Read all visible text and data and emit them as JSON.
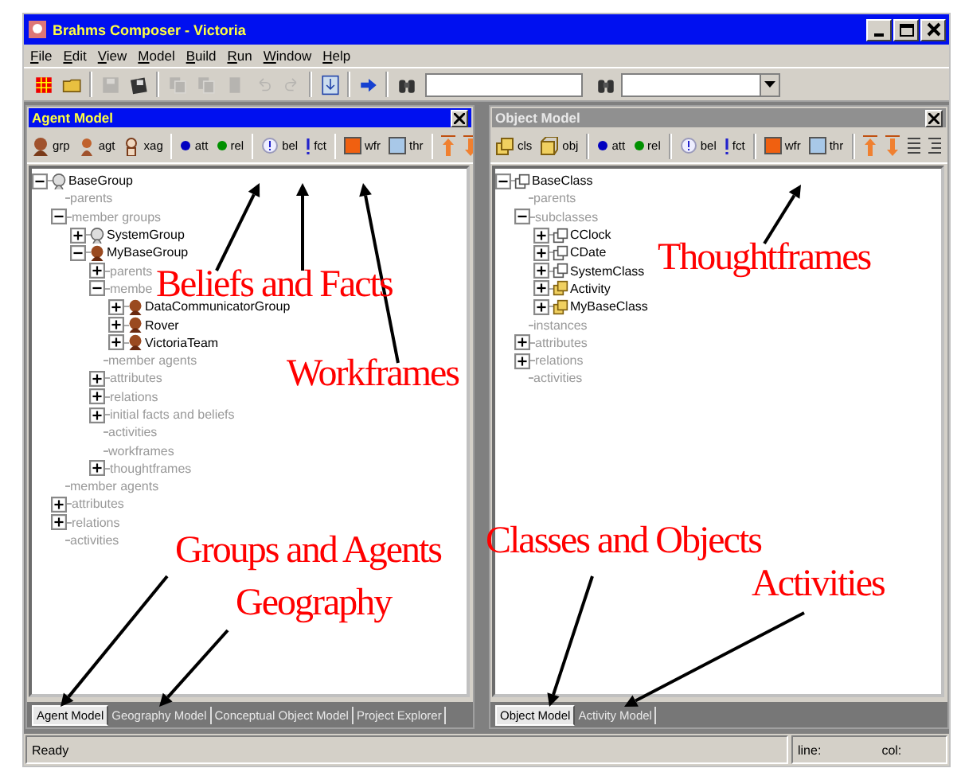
{
  "window": {
    "title": "Brahms Composer - Victoria"
  },
  "menu": [
    "File",
    "Edit",
    "View",
    "Model",
    "Build",
    "Run",
    "Window",
    "Help"
  ],
  "toolbar": [
    {
      "kind": "new",
      "disabled": false
    },
    {
      "kind": "open",
      "disabled": false
    },
    {
      "kind": "separator"
    },
    {
      "kind": "save",
      "disabled": true
    },
    {
      "kind": "save-all",
      "disabled": false
    },
    {
      "kind": "separator"
    },
    {
      "kind": "copy",
      "disabled": true
    },
    {
      "kind": "paste",
      "disabled": true
    },
    {
      "kind": "cut",
      "disabled": true
    },
    {
      "kind": "undo",
      "disabled": true
    },
    {
      "kind": "redo",
      "disabled": true
    },
    {
      "kind": "separator"
    },
    {
      "kind": "compile",
      "disabled": false
    },
    {
      "kind": "separator"
    },
    {
      "kind": "run",
      "disabled": false
    },
    {
      "kind": "separator"
    },
    {
      "kind": "find",
      "disabled": false
    },
    {
      "kind": "text-field"
    },
    {
      "kind": "find",
      "disabled": false
    },
    {
      "kind": "combo"
    }
  ],
  "panels": [
    {
      "title": "Agent Model",
      "active": true,
      "tools": [
        [
          {
            "kind": "group",
            "label": "grp"
          },
          {
            "kind": "agent",
            "label": "agt"
          },
          {
            "kind": "external-agent",
            "label": "xag"
          }
        ],
        [
          {
            "kind": "attribute",
            "label": "att"
          },
          {
            "kind": "relation",
            "label": "rel"
          }
        ],
        [
          {
            "kind": "belief",
            "label": "bel"
          },
          {
            "kind": "fact",
            "label": "fct"
          }
        ],
        [
          {
            "kind": "workframe",
            "label": "wfr"
          },
          {
            "kind": "thoughtframe",
            "label": "thr"
          }
        ],
        [
          {
            "kind": "move-up"
          },
          {
            "kind": "move-down"
          }
        ]
      ],
      "tree": [
        {
          "label": "BaseGroup",
          "kind": "system-group",
          "expanded": true,
          "children": [
            {
              "label": "parents",
              "kind": "category"
            },
            {
              "label": "member groups",
              "kind": "category",
              "expanded": true,
              "children": [
                {
                  "label": "SystemGroup",
                  "kind": "system-group",
                  "expanded": false
                },
                {
                  "label": "MyBaseGroup",
                  "kind": "group",
                  "expanded": true,
                  "children": [
                    {
                      "label": "parents",
                      "kind": "category",
                      "expanded": false
                    },
                    {
                      "label": "membe",
                      "kind": "category",
                      "expanded": true,
                      "children": [
                        {
                          "label": "DataCommunicatorGroup",
                          "kind": "group",
                          "expanded": false
                        },
                        {
                          "label": "Rover",
                          "kind": "group",
                          "expanded": false
                        },
                        {
                          "label": "VictoriaTeam",
                          "kind": "group",
                          "expanded": false
                        }
                      ]
                    },
                    {
                      "label": "member agents",
                      "kind": "category"
                    },
                    {
                      "label": "attributes",
                      "kind": "category",
                      "expanded": false
                    },
                    {
                      "label": "relations",
                      "kind": "category",
                      "expanded": false
                    },
                    {
                      "label": "initial facts and beliefs",
                      "kind": "category",
                      "expanded": false
                    },
                    {
                      "label": "activities",
                      "kind": "category"
                    },
                    {
                      "label": "workframes",
                      "kind": "category"
                    },
                    {
                      "label": "thoughtframes",
                      "kind": "category",
                      "expanded": false
                    }
                  ]
                }
              ]
            },
            {
              "label": "member agents",
              "kind": "category"
            },
            {
              "label": "attributes",
              "kind": "category",
              "expanded": false
            },
            {
              "label": "relations",
              "kind": "category",
              "expanded": false
            },
            {
              "label": "activities",
              "kind": "category"
            }
          ]
        }
      ],
      "tabs": [
        {
          "label": "Agent Model",
          "selected": true
        },
        {
          "label": "Geography Model",
          "selected": false
        },
        {
          "label": "Conceptual Object Model",
          "selected": false
        },
        {
          "label": "Project Explorer",
          "selected": false
        }
      ]
    },
    {
      "title": "Object Model",
      "active": false,
      "tools": [
        [
          {
            "kind": "class",
            "label": "cls"
          },
          {
            "kind": "object",
            "label": "obj"
          }
        ],
        [
          {
            "kind": "attribute",
            "label": "att"
          },
          {
            "kind": "relation",
            "label": "rel"
          }
        ],
        [
          {
            "kind": "belief",
            "label": "bel"
          },
          {
            "kind": "fact",
            "label": "fct"
          }
        ],
        [
          {
            "kind": "workframe",
            "label": "wfr"
          },
          {
            "kind": "thoughtframe",
            "label": "thr"
          }
        ],
        [
          {
            "kind": "move-up"
          },
          {
            "kind": "move-down"
          },
          {
            "kind": "list"
          },
          {
            "kind": "list-indent"
          }
        ]
      ],
      "tree": [
        {
          "label": "BaseClass",
          "kind": "system-class",
          "expanded": true,
          "children": [
            {
              "label": "parents",
              "kind": "category"
            },
            {
              "label": "subclasses",
              "kind": "category",
              "expanded": true,
              "children": [
                {
                  "label": "CClock",
                  "kind": "system-class",
                  "expanded": false
                },
                {
                  "label": "CDate",
                  "kind": "system-class",
                  "expanded": false
                },
                {
                  "label": "SystemClass",
                  "kind": "system-class",
                  "expanded": false
                },
                {
                  "label": "Activity",
                  "kind": "class",
                  "expanded": false
                },
                {
                  "label": "MyBaseClass",
                  "kind": "class",
                  "expanded": false
                }
              ]
            },
            {
              "label": "instances",
              "kind": "category"
            },
            {
              "label": "attributes",
              "kind": "category",
              "expanded": false
            },
            {
              "label": "relations",
              "kind": "category",
              "expanded": false
            },
            {
              "label": "activities",
              "kind": "category"
            }
          ]
        }
      ],
      "tabs": [
        {
          "label": "Object Model",
          "selected": true
        },
        {
          "label": "Activity Model",
          "selected": false
        }
      ]
    }
  ],
  "status_bar": {
    "message": "Ready",
    "line": "line:",
    "col": "col:"
  },
  "annotations": [
    {
      "text": "Beliefs and Facts"
    },
    {
      "text": "Workframes"
    },
    {
      "text": "Thoughtframes"
    },
    {
      "text": "Groups and Agents"
    },
    {
      "text": "Geography"
    },
    {
      "text": "Classes and Objects"
    },
    {
      "text": "Activities"
    }
  ]
}
